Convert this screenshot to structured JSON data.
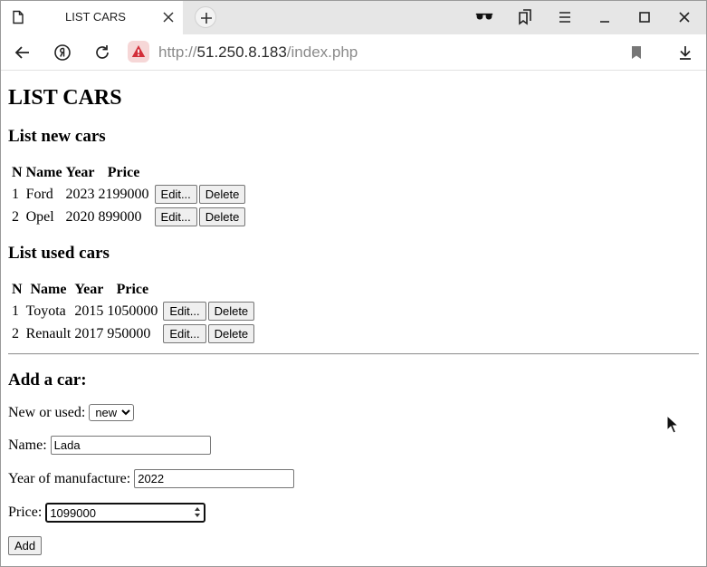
{
  "browser": {
    "tab_title": "LIST CARS",
    "url_scheme": "http://",
    "url_host": "51.250.8.183",
    "url_path": "/index.php"
  },
  "page": {
    "title": "LIST CARS",
    "new_cars": {
      "heading": "List new cars",
      "columns": [
        "N",
        "Name",
        "Year",
        "Price"
      ],
      "rows": [
        {
          "n": "1",
          "name": "Ford",
          "year": "2023",
          "price": "2199000"
        },
        {
          "n": "2",
          "name": "Opel",
          "year": "2020",
          "price": "899000"
        }
      ]
    },
    "used_cars": {
      "heading": "List used cars",
      "columns": [
        "N",
        "Name",
        "Year",
        "Price"
      ],
      "rows": [
        {
          "n": "1",
          "name": "Toyota",
          "year": "2015",
          "price": "1050000"
        },
        {
          "n": "2",
          "name": "Renault",
          "year": "2017",
          "price": "950000"
        }
      ]
    },
    "edit_label": "Edit...",
    "delete_label": "Delete",
    "add_form": {
      "heading": "Add a car:",
      "type_label": "New or used:",
      "type_value": "new",
      "name_label": "Name:",
      "name_value": "Lada",
      "year_label": "Year of manufacture:",
      "year_value": "2022",
      "price_label": "Price:",
      "price_value": "1099000",
      "submit_label": "Add"
    }
  },
  "icons": {
    "toolbar": [
      "incognito-glasses-icon",
      "bookmarks-collections-icon",
      "menu-icon",
      "minimize-icon",
      "maximize-icon",
      "close-window-icon"
    ],
    "nav": [
      "back-arrow-icon",
      "yandex-icon",
      "reload-icon",
      "security-warning-icon",
      "bookmark-icon",
      "download-icon"
    ]
  },
  "colors": {
    "warning_badge_bg": "#f6d7d7",
    "warning_icon": "#d32f3a",
    "tabbar_bg": "#e6e6e6"
  }
}
